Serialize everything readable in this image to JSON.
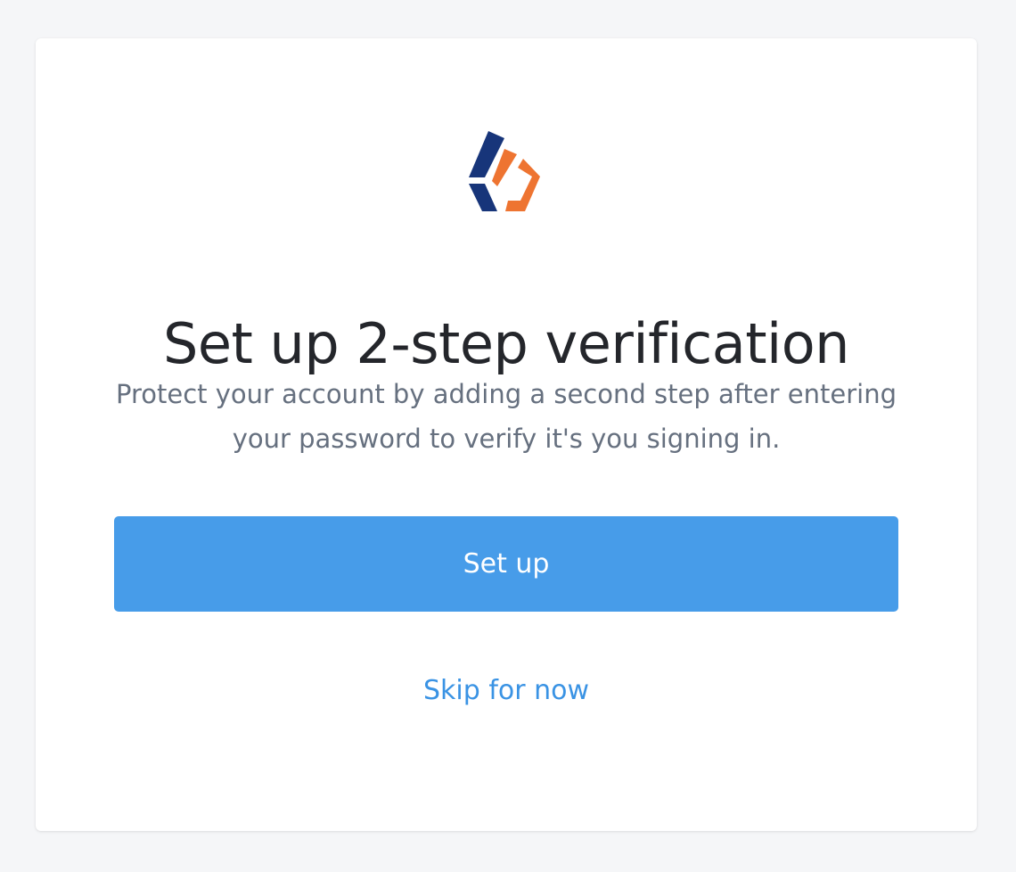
{
  "logo": {
    "icon": "brand-logo-icon",
    "colors": {
      "navy": "#17357a",
      "orange": "#ee7431"
    }
  },
  "page": {
    "title": "Set up 2-step verification",
    "subtitle": "Protect your account by adding a second step after entering your password to verify it's you signing in."
  },
  "actions": {
    "setup_label": "Set up",
    "skip_label": "Skip for now"
  },
  "colors": {
    "primary_button": "#479ce9",
    "link": "#3a93e4",
    "background": "#f5f6f8"
  }
}
